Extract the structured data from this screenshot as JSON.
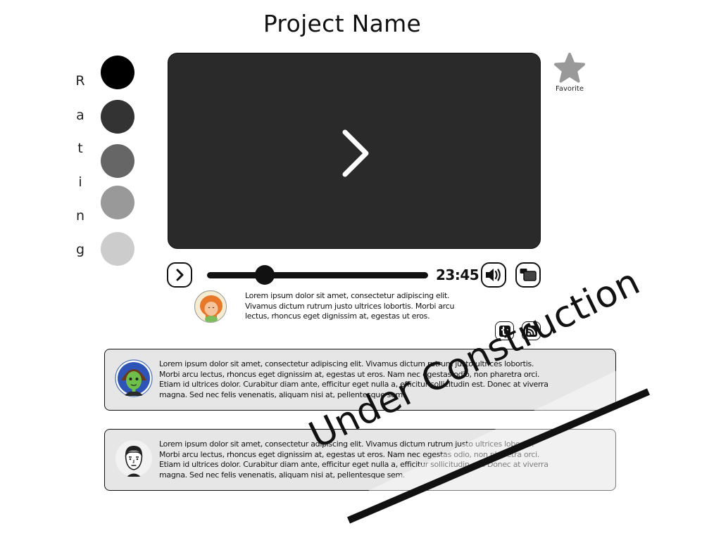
{
  "page": {
    "title": "Project Name"
  },
  "rating": {
    "letters": [
      "R",
      "a",
      "t",
      "i",
      "n",
      "g"
    ],
    "levels": [
      "#000000",
      "#333333",
      "#666666",
      "#999999",
      "#cccccc"
    ]
  },
  "favorite": {
    "label": "Favorite",
    "icon": "star-icon"
  },
  "player": {
    "time": "23:45",
    "progress": 0.26,
    "play_icon": "play-icon",
    "volume_icon": "volume-icon",
    "window_icon": "window-icon"
  },
  "description": {
    "text": "Lorem ipsum dolor sit amet, consectetur adipiscing elit. Vivamus dictum rutrum justo ultrices lobortis. Morbi arcu lectus, rhoncus eget dignissim at, egestas ut eros."
  },
  "social": {
    "twitter_icon": "twitter-icon",
    "rss_icon": "rss-icon"
  },
  "comments": [
    {
      "text": "Lorem ipsum dolor sit amet, consectetur adipiscing elit. Vivamus dictum rutrum justo ultrices lobortis. Morbi arcu lectus, rhoncus eget dignissim at, egestas ut eros. Nam nec egestas odio, non pharetra orci. Etiam id ultrices dolor. Curabitur diam ante, efficitur eget nulla a, efficitur sollicitudin est. Donec at viverra magna. Sed nec felis venenatis, aliquam nisi at, pellentesque sem."
    },
    {
      "text": "Lorem ipsum dolor sit amet, consectetur adipiscing elit. Vivamus dictum rutrum justo ultrices lobortis. Morbi arcu lectus, rhoncus eget dignissim at, egestas ut eros. Nam nec egestas odio, non pharetra orci. Etiam id ultrices dolor. Curabitur diam ante, efficitur eget nulla a, efficitur sollicitudin est. Donec at viverra magna. Sed nec felis venenatis, aliquam nisi at, pellentesque sem."
    }
  ],
  "overlay": {
    "text": "Under Construction"
  }
}
